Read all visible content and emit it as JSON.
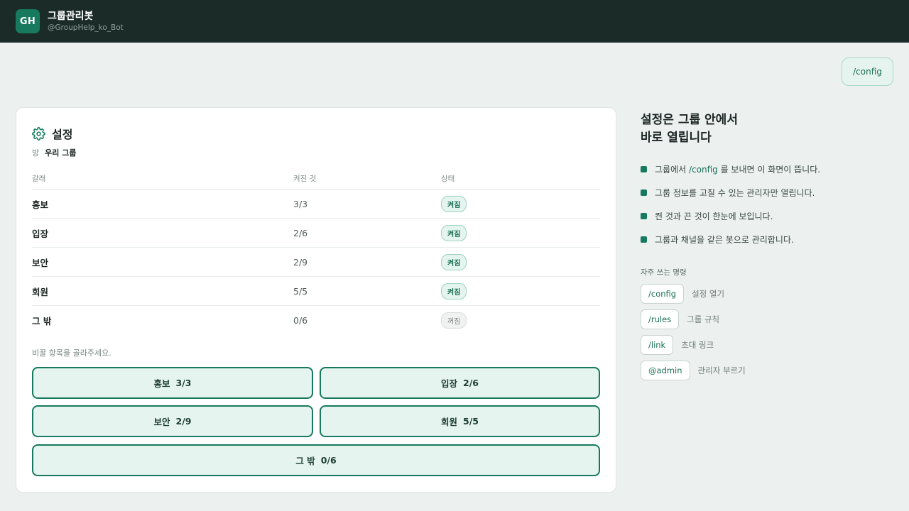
{
  "header": {
    "logo_text": "GH",
    "bot_name": "그룹관리봇",
    "bot_handle": "@GroupHelp_ko_Bot"
  },
  "config_pill": "/config",
  "settings": {
    "title": "설정",
    "room_label": "방",
    "room_value": "우리 그룹",
    "columns": [
      "갈래",
      "켜진 것",
      "상태"
    ],
    "rows": [
      {
        "name": "홍보",
        "count": "3/3",
        "status": "켜짐",
        "on": true
      },
      {
        "name": "입장",
        "count": "2/6",
        "status": "켜짐",
        "on": true
      },
      {
        "name": "보안",
        "count": "2/9",
        "status": "켜짐",
        "on": true
      },
      {
        "name": "회원",
        "count": "5/5",
        "status": "켜짐",
        "on": true
      },
      {
        "name": "그 밖",
        "count": "0/6",
        "status": "꺼짐",
        "on": false
      }
    ],
    "hint": "비꿀 항목을 골라주세요.",
    "buttons": [
      {
        "name": "홍보",
        "count": "3/3"
      },
      {
        "name": "입장",
        "count": "2/6"
      },
      {
        "name": "보안",
        "count": "2/9"
      },
      {
        "name": "회원",
        "count": "5/5"
      },
      {
        "name": "그 밖",
        "count": "0/6"
      }
    ]
  },
  "side": {
    "heading_line1": "설정은 그룹 안에서",
    "heading_line2": "바로 열립니다",
    "bullets": [
      {
        "pre": "그룹에서 ",
        "code": "/config",
        "post": " 를 보내면 이 화면이 뜹니다."
      },
      {
        "pre": "그룹 정보를 고칠 수 있는 관리자만 열립니다.",
        "code": "",
        "post": ""
      },
      {
        "pre": "켠 것과 끈 것이 한눈에 보입니다.",
        "code": "",
        "post": ""
      },
      {
        "pre": "그룹과 채널을 같은 봇으로 관리합니다.",
        "code": "",
        "post": ""
      }
    ],
    "commands_heading": "자주 쓰는 명령",
    "commands": [
      {
        "cmd": "/config",
        "desc": "설정 열기"
      },
      {
        "cmd": "/rules",
        "desc": "그룹 규칙"
      },
      {
        "cmd": "/link",
        "desc": "초대 링크"
      },
      {
        "cmd": "@admin",
        "desc": "관리자 부르기"
      }
    ]
  },
  "colors": {
    "accent": "#177a5e",
    "topbar": "#1b2b27",
    "background": "#ecf1f0"
  }
}
